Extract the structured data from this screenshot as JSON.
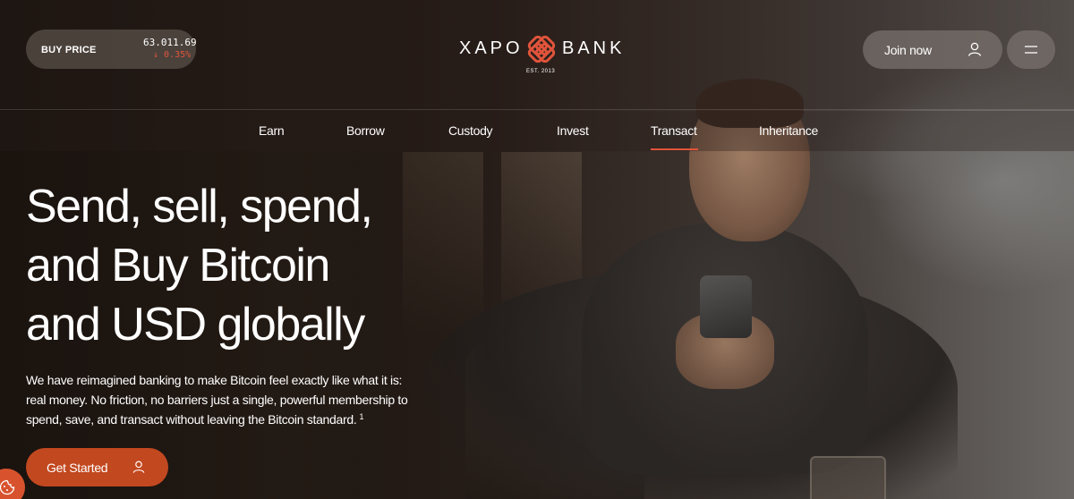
{
  "ticker": {
    "label": "BUY PRICE",
    "value": "63.011.69",
    "change": "↓ 0.35%",
    "change_color": "#e0543b"
  },
  "brand": {
    "left": "XAPO",
    "right": "BANK",
    "est": "EST. 2013",
    "accent": "#e0543b"
  },
  "header": {
    "join_label": "Join now",
    "join_icon": "user-icon",
    "menu_icon": "hamburger-menu-icon"
  },
  "nav": {
    "items": [
      "Earn",
      "Borrow",
      "Custody",
      "Invest",
      "Transact",
      "Inheritance"
    ],
    "active": "Transact"
  },
  "hero": {
    "headline": [
      "Send, sell, spend,",
      "and Buy Bitcoin",
      "and USD globally"
    ],
    "subtext": "We have reimagined banking to make Bitcoin feel exactly like what it is: real money. No friction, no barriers just a single, powerful membership to spend, save, and transact without leaving the Bitcoin standard.",
    "footnote": "1",
    "cta_label": "Get Started",
    "cta_icon": "user-icon",
    "cta_color": "#c2481f"
  },
  "cookie": {
    "icon": "cookie-icon"
  }
}
